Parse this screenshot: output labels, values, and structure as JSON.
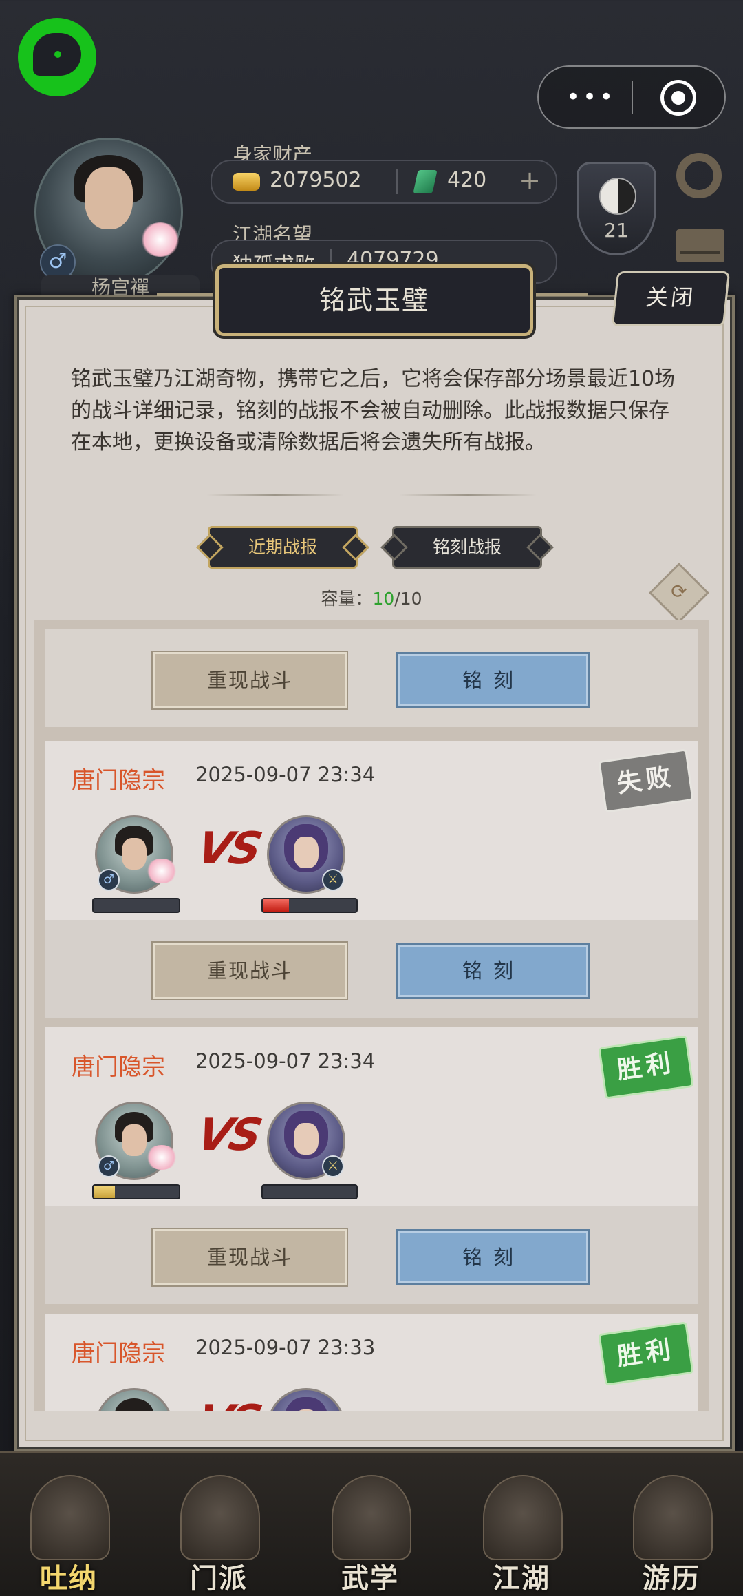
{
  "header": {
    "wealth_label": "身家财产",
    "gold": "2079502",
    "jade": "420",
    "reputation_label": "江湖名望",
    "reputation_title": "独孤求败",
    "reputation_value": "4079729",
    "player_name": "杨宫禪",
    "level": "21"
  },
  "dialog": {
    "title": "铭武玉璧",
    "close_label": "关闭",
    "description": "铭武玉璧乃江湖奇物，携带它之后，它将会保存部分场景最近10场的战斗详细记录，铭刻的战报不会被自动删除。此战报数据只保存在本地，更换设备或清除数据后将会遗失所有战报。",
    "tabs": [
      {
        "label": "近期战报",
        "active": true
      },
      {
        "label": "铭刻战报",
        "active": false
      }
    ],
    "capacity_label": "容量：",
    "capacity_current": "10",
    "capacity_max": "/10"
  },
  "records": [
    {
      "sect": "唐门隐宗",
      "time": "2025-09-07 23:34",
      "result": "失败",
      "player_hp": 0.0,
      "enemy_hp": 0.28
    },
    {
      "sect": "唐门隐宗",
      "time": "2025-09-07 23:34",
      "result": "胜利",
      "player_hp": 0.25,
      "enemy_hp": 0.0
    },
    {
      "sect": "唐门隐宗",
      "time": "2025-09-07 23:33",
      "result": "胜利"
    }
  ],
  "actions": {
    "replay_label": "重现战斗",
    "engrave_label": "铭刻"
  },
  "vs_text": "VS",
  "nav": [
    {
      "label": "吐纳",
      "active": true
    },
    {
      "label": "门派",
      "active": false
    },
    {
      "label": "武学",
      "active": false
    },
    {
      "label": "江湖",
      "active": false
    },
    {
      "label": "游历",
      "active": false
    }
  ],
  "colors": {
    "sect_name": "#d8562b",
    "stamp_win": "#3a9f44",
    "stamp_lose": "#7c7b79",
    "capacity_current": "#2ea12e",
    "engrave_button": "#82a8cd",
    "replay_button": "#c2b6a3"
  },
  "icons": [
    "chat-bubble-icon",
    "more-dots-icon",
    "target-icon",
    "gold-ingot-icon",
    "jade-icon",
    "plus-icon",
    "yinyang-icon",
    "gear-icon",
    "mail-icon",
    "refresh-icon",
    "male-icon"
  ]
}
